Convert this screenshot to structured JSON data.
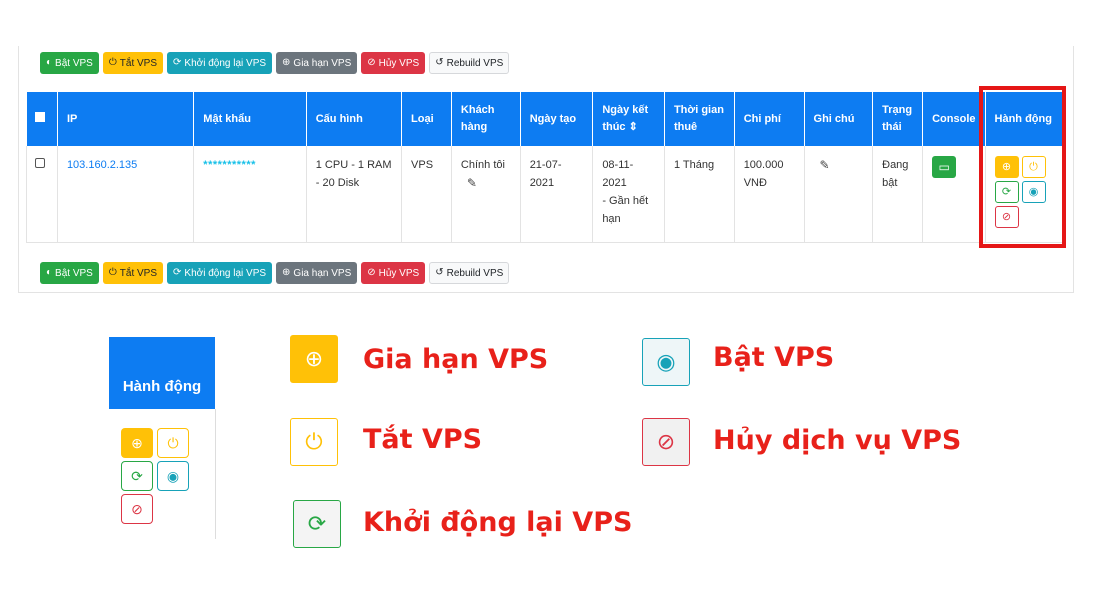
{
  "toolbar": {
    "buttons": [
      {
        "label": "Bật VPS",
        "icon": "toggle-icon",
        "color": "#28a745"
      },
      {
        "label": "Tắt VPS",
        "icon": "power-icon",
        "color": "#ffc107"
      },
      {
        "label": "Khởi động lại VPS",
        "icon": "refresh-icon",
        "color": "#17a2b8"
      },
      {
        "label": "Gia hạn VPS",
        "icon": "plus-circle-icon",
        "color": "#6c757d"
      },
      {
        "label": "Hủy VPS",
        "icon": "ban-icon",
        "color": "#dc3545"
      },
      {
        "label": "Rebuild VPS",
        "icon": "history-icon",
        "color": "#f8f9fa"
      }
    ]
  },
  "table": {
    "headers": [
      "",
      "IP",
      "Mật khẩu",
      "Cấu hình",
      "Loại",
      "Khách hàng",
      "Ngày tạo",
      "Ngày kết thúc",
      "Thời gian thuê",
      "Chi phí",
      "Ghi chú",
      "Trạng thái",
      "Console",
      "Hành động"
    ],
    "sort_icon": "⇕",
    "rows": [
      {
        "ip": "103.160.2.135",
        "password": "***********",
        "config": "1 CPU - 1 RAM - 20 Disk",
        "type": "VPS",
        "customer": "Chính tôi",
        "created": "21-07-2021",
        "end_date": "08-11-2021",
        "end_note": "- Gần hết hạn",
        "duration": "1 Tháng",
        "cost": "100.000 VNĐ",
        "status": "Đang bật"
      }
    ]
  },
  "legend": {
    "header": "Hành động",
    "items": [
      {
        "label": "Gia hạn VPS",
        "icon": "plus-circle-icon"
      },
      {
        "label": "Tắt VPS",
        "icon": "power-icon"
      },
      {
        "label": "Khởi động lại VPS",
        "icon": "refresh-icon"
      },
      {
        "label": "Bật VPS",
        "icon": "stop-circle-icon"
      },
      {
        "label": "Hủy dịch vụ VPS",
        "icon": "ban-icon"
      }
    ]
  },
  "colors": {
    "header_blue": "#0d7cf2",
    "highlight_red": "#e51616",
    "label_red": "#e8211a"
  }
}
